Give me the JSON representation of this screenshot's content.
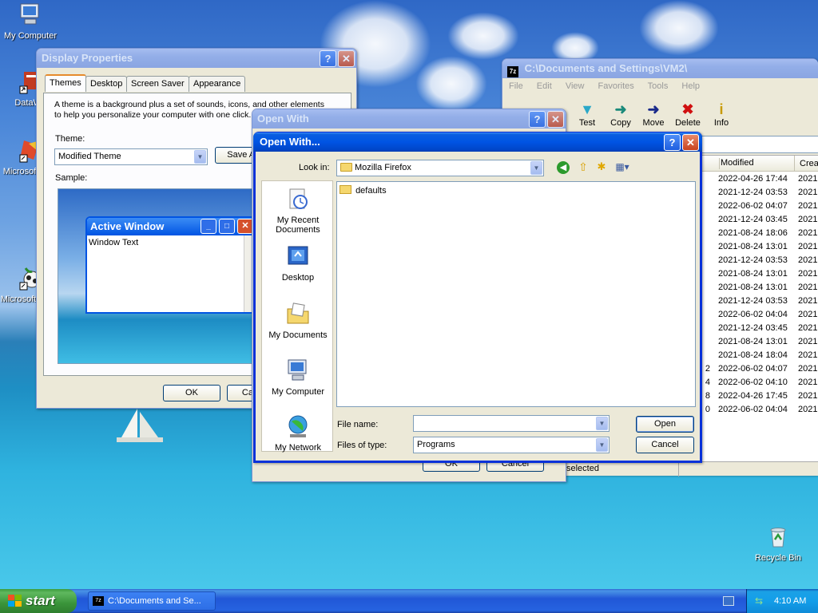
{
  "desktop": {
    "icons": [
      {
        "label": "My Computer"
      },
      {
        "label": "DataWa"
      },
      {
        "label": "Microsoft C++"
      },
      {
        "label": "Microsoft Basic"
      },
      {
        "label": "Recycle Bin"
      }
    ]
  },
  "display_properties": {
    "title": "Display Properties",
    "tabs": [
      "Themes",
      "Desktop",
      "Screen Saver",
      "Appearance"
    ],
    "description": "A theme is a background plus a set of sounds, icons, and other elements to help you personalize your computer with one click.",
    "theme_label": "Theme:",
    "theme_value": "Modified Theme",
    "save_as_label": "Save As...",
    "sample_label": "Sample:",
    "preview_window_title": "Active Window",
    "preview_window_text": "Window Text",
    "ok_label": "OK",
    "cancel_label": "Cancel"
  },
  "explorer": {
    "title": "C:\\Documents and Settings\\VM2\\",
    "menu": [
      "File",
      "Edit",
      "View",
      "Favorites",
      "Tools",
      "Help"
    ],
    "toolbar": [
      "Test",
      "Copy",
      "Move",
      "Delete",
      "Info"
    ],
    "columns": {
      "modified": "Modified",
      "created": "Crea"
    },
    "rows": [
      {
        "size_tail": "",
        "modified": "2022-04-26 17:44",
        "created": "2021-"
      },
      {
        "size_tail": "",
        "modified": "2021-12-24 03:53",
        "created": "2021-"
      },
      {
        "size_tail": "",
        "modified": "2022-06-02 04:07",
        "created": "2021-"
      },
      {
        "size_tail": "",
        "modified": "2021-12-24 03:45",
        "created": "2021-"
      },
      {
        "size_tail": "",
        "modified": "2021-08-24 18:06",
        "created": "2021-"
      },
      {
        "size_tail": "",
        "modified": "2021-08-24 13:01",
        "created": "2021-"
      },
      {
        "size_tail": "",
        "modified": "2021-12-24 03:53",
        "created": "2021-"
      },
      {
        "size_tail": "",
        "modified": "2021-08-24 13:01",
        "created": "2021-"
      },
      {
        "size_tail": "",
        "modified": "2021-08-24 13:01",
        "created": "2021-"
      },
      {
        "size_tail": "",
        "modified": "2021-12-24 03:53",
        "created": "2021-"
      },
      {
        "size_tail": "",
        "modified": "2022-06-02 04:04",
        "created": "2021-"
      },
      {
        "size_tail": "",
        "modified": "2021-12-24 03:45",
        "created": "2021-"
      },
      {
        "size_tail": "",
        "modified": "2021-08-24 13:01",
        "created": "2021-"
      },
      {
        "size_tail": "",
        "modified": "2021-08-24 18:04",
        "created": "2021-"
      },
      {
        "size_tail": "2",
        "modified": "2022-06-02 04:07",
        "created": "2021-"
      },
      {
        "size_tail": "4",
        "modified": "2022-06-02 04:10",
        "created": "2021-"
      },
      {
        "size_tail": "8",
        "modified": "2022-04-26 17:45",
        "created": "2021-"
      },
      {
        "size_tail": "0",
        "modified": "2022-06-02 04:04",
        "created": "2021-"
      }
    ],
    "status_text": "selected"
  },
  "open_with_back": {
    "title": "Open With",
    "ok_label": "OK",
    "cancel_label": "Cancel"
  },
  "open_with_dialog": {
    "title": "Open With...",
    "look_in_label": "Look in:",
    "look_in_value": "Mozilla Firefox",
    "places": [
      "My Recent Documents",
      "Desktop",
      "My Documents",
      "My Computer",
      "My Network"
    ],
    "files": [
      "defaults"
    ],
    "file_name_label": "File name:",
    "file_name_value": "",
    "files_of_type_label": "Files of type:",
    "files_of_type_value": "Programs",
    "open_label": "Open",
    "cancel_label": "Cancel"
  },
  "taskbar": {
    "start_label": "start",
    "task_label": "C:\\Documents and Se...",
    "clock": "4:10 AM"
  }
}
